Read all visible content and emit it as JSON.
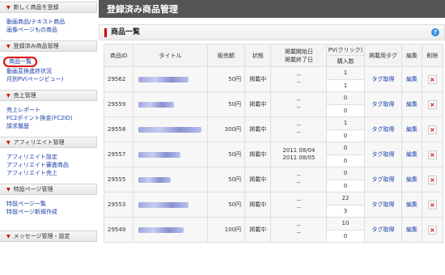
{
  "sidebar": {
    "sections": [
      {
        "heading": "新しく商品を登録",
        "links": [
          "動画商品/テキスト商品",
          "画像ページもの商品"
        ]
      },
      {
        "heading": "登録済み商品管理",
        "links": [
          "商品一覧",
          "動画変換進捗状況",
          "月別PV(ページビュー)"
        ],
        "active_index": 0
      },
      {
        "heading": "売上管理",
        "links": [
          "売上レポート",
          "FC2ポイント換金(FC2ID)",
          "請求履歴"
        ]
      },
      {
        "heading": "アフィリエイト管理",
        "links": [
          "アフィリエイト設定",
          "アフィリエイト審査商品",
          "アフィリエイト売上"
        ]
      },
      {
        "heading": "特設ページ管理",
        "links": [
          "特設ページ一覧",
          "特設ページ新規作成"
        ]
      }
    ],
    "footer_heading": "メッセージ管理・設定"
  },
  "page_title": "登録済み商品管理",
  "section_title": "商品一覧",
  "table": {
    "headers": {
      "id": "商品ID",
      "title": "タイトル",
      "price": "販売額",
      "status": "状態",
      "period_start": "掲載開始日",
      "period_end": "掲載終了日",
      "pv": "PV(クリック)",
      "buyers": "購入数",
      "tag": "掲載用タグ",
      "edit": "編集",
      "delete": "削除"
    },
    "rows": [
      {
        "id": "29562",
        "price": "50円",
        "status": "掲載中",
        "start": "--",
        "end": "--",
        "pv": "1",
        "buyers": "1",
        "tag": "タグ取得",
        "edit": "編集"
      },
      {
        "id": "29559",
        "price": "50円",
        "status": "掲載中",
        "start": "--",
        "end": "--",
        "pv": "0",
        "buyers": "0",
        "tag": "タグ取得",
        "edit": "編集"
      },
      {
        "id": "29558",
        "price": "300円",
        "status": "掲載中",
        "start": "--",
        "end": "--",
        "pv": "1",
        "buyers": "0",
        "tag": "タグ取得",
        "edit": "編集"
      },
      {
        "id": "29557",
        "price": "50円",
        "status": "掲載中",
        "start": "2011 08/04",
        "end": "2011 08/05",
        "pv": "0",
        "buyers": "0",
        "tag": "タグ取得",
        "edit": "編集"
      },
      {
        "id": "29555",
        "price": "50円",
        "status": "掲載中",
        "start": "--",
        "end": "--",
        "pv": "0",
        "buyers": "0",
        "tag": "タグ取得",
        "edit": "編集"
      },
      {
        "id": "29553",
        "price": "50円",
        "status": "掲載中",
        "start": "--",
        "end": "--",
        "pv": "22",
        "buyers": "3",
        "tag": "タグ取得",
        "edit": "編集"
      },
      {
        "id": "29549",
        "price": "100円",
        "status": "掲載中",
        "start": "--",
        "end": "--",
        "pv": "10",
        "buyers": "0",
        "tag": "タグ取得",
        "edit": "編集"
      }
    ]
  },
  "colors": {
    "accent": "#cc0000",
    "link": "#1a3ea8",
    "title_bar": "#555555",
    "help": "#3d8fe0"
  },
  "icons": {
    "section_marker": "triangle-right-icon",
    "help": "help-icon",
    "delete": "close-icon"
  }
}
